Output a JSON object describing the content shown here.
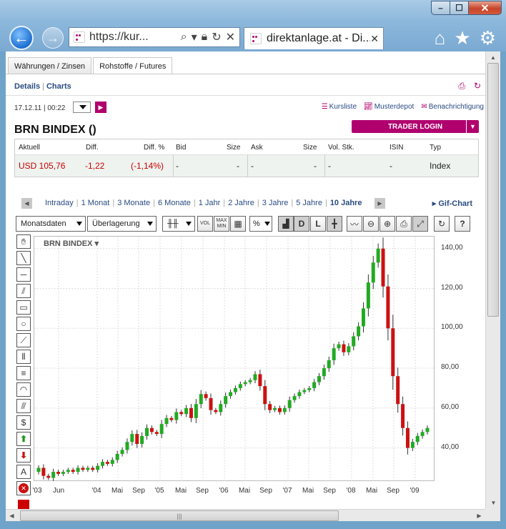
{
  "browser": {
    "url": "https://kur...",
    "tab_title": "direktanlage.at - Di..."
  },
  "page": {
    "subtabs": [
      "Währungen / Zinsen",
      "Rohstoffe / Futures"
    ],
    "links": {
      "details": "Details",
      "charts": "Charts"
    },
    "timestamp": "17.12.11 | 00:22",
    "actions": [
      "Kursliste",
      "Musterdepot",
      "Benachrichtigung"
    ],
    "title": "BRN BINDEX ()",
    "trader_login": "TRADER LOGIN",
    "quote_headers": [
      "Aktuell",
      "Diff.",
      "Diff. %",
      "Bid",
      "Size",
      "Ask",
      "Size",
      "Vol. Stk.",
      "ISIN",
      "Typ"
    ],
    "quote_values": [
      "USD 105,76",
      "-1,22",
      "(-1,14%)",
      "-",
      "-",
      "-",
      "-",
      "-",
      "-",
      "Index"
    ]
  },
  "periods": [
    "Intraday",
    "1 Monat",
    "3 Monate",
    "6 Monate",
    "1 Jahr",
    "2 Jahre",
    "3 Jahre",
    "5 Jahre",
    "10 Jahre"
  ],
  "gif_chart": "Gif-Chart",
  "chart_controls": {
    "data_select": "Monatsdaten",
    "overlay_select": "Überlagerung"
  },
  "chart_toolbar": {
    "vol": "VOL",
    "maxmin_top": "MAX",
    "maxmin_bottom": "MIN",
    "percent": "%",
    "d": "D",
    "l": "L",
    "help": "?"
  },
  "left_tools": {
    "text": "A"
  },
  "chart_data": {
    "type": "candlestick",
    "title": "BRN BINDEX",
    "x_tick_labels": [
      "'03",
      "Jun",
      "'04",
      "Mai",
      "Sep",
      "'05",
      "Mai",
      "Sep",
      "'06",
      "Mai",
      "Sep",
      "'07",
      "Mai",
      "Sep",
      "'08",
      "Mai",
      "Sep",
      "'09"
    ],
    "y_tick_labels": [
      "40,00",
      "60,00",
      "80,00",
      "100,00",
      "120,00",
      "140,00"
    ],
    "ylim": [
      23,
      146
    ],
    "grid": true,
    "colors": {
      "up": "#22aa22",
      "down": "#cc1111"
    },
    "monthly_close": [
      30,
      26,
      25,
      28,
      27,
      28,
      29,
      28,
      30,
      29,
      30,
      29,
      31,
      33,
      32,
      34,
      37,
      39,
      43,
      47,
      42,
      46,
      50,
      48,
      47,
      52,
      55,
      54,
      58,
      57,
      60,
      55,
      62,
      67,
      65,
      59,
      58,
      62,
      66,
      68,
      70,
      72,
      73,
      74,
      77,
      71,
      62,
      59,
      60,
      58,
      60,
      64,
      66,
      68,
      69,
      70,
      73,
      76,
      80,
      84,
      90,
      92,
      88,
      91,
      96,
      101,
      110,
      123,
      133,
      140,
      121,
      100,
      76,
      62,
      50,
      40,
      43,
      46,
      48,
      50
    ]
  }
}
